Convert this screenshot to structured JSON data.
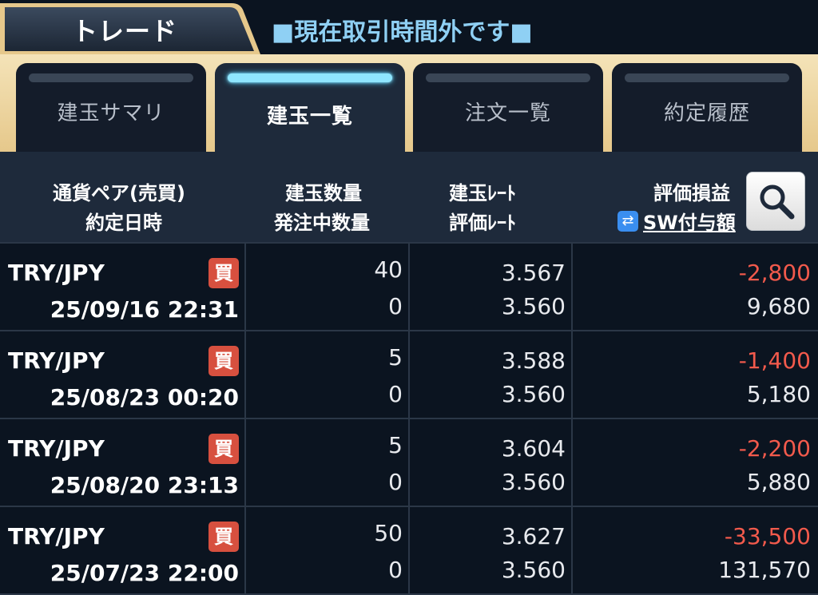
{
  "header": {
    "title": "トレード",
    "status": "■現在取引時間外です■"
  },
  "tabs": [
    {
      "label": "建玉サマリ",
      "active": false
    },
    {
      "label": "建玉一覧",
      "active": true
    },
    {
      "label": "注文一覧",
      "active": false
    },
    {
      "label": "約定履歴",
      "active": false
    }
  ],
  "columns": {
    "pair_side": "通貨ペア(売買)",
    "exec_datetime": "約定日時",
    "position_qty": "建玉数量",
    "pending_qty": "発注中数量",
    "position_rate": "建玉ﾚｰﾄ",
    "valuation_rate": "評価ﾚｰﾄ",
    "unrealized_pl": "評価損益",
    "swap_link": "SW付与額",
    "swap_icon": "swap-arrows-icon",
    "search_icon": "magnifier-icon"
  },
  "colors": {
    "accent": "#8fe6ff",
    "loss": "#f25a4c",
    "buy_badge": "#d7503f",
    "gold": "#e6c88b"
  },
  "positions": [
    {
      "pair": "TRY/JPY",
      "side": "買",
      "datetime": "25/09/16 22:31",
      "qty": "40",
      "pending": "0",
      "rate": "3.567",
      "eval_rate": "3.560",
      "pl": "-2,800",
      "swap": "9,680"
    },
    {
      "pair": "TRY/JPY",
      "side": "買",
      "datetime": "25/08/23 00:20",
      "qty": "5",
      "pending": "0",
      "rate": "3.588",
      "eval_rate": "3.560",
      "pl": "-1,400",
      "swap": "5,180"
    },
    {
      "pair": "TRY/JPY",
      "side": "買",
      "datetime": "25/08/20 23:13",
      "qty": "5",
      "pending": "0",
      "rate": "3.604",
      "eval_rate": "3.560",
      "pl": "-2,200",
      "swap": "5,880"
    },
    {
      "pair": "TRY/JPY",
      "side": "買",
      "datetime": "25/07/23 22:00",
      "qty": "50",
      "pending": "0",
      "rate": "3.627",
      "eval_rate": "3.560",
      "pl": "-33,500",
      "swap": "131,570"
    }
  ]
}
